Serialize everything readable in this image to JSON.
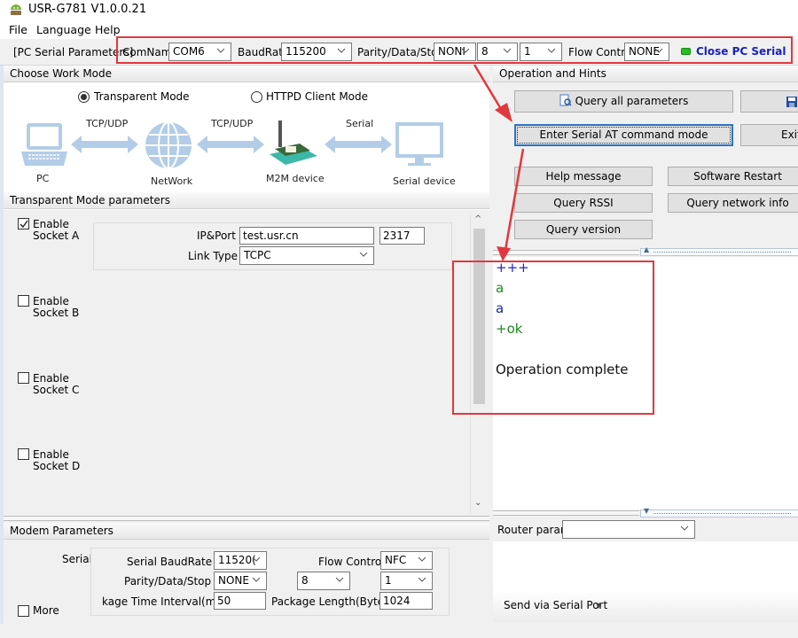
{
  "window": {
    "title": "USR-G781 V1.0.0.21",
    "app_icon": "android-robot-icon"
  },
  "menu": {
    "items": [
      "File",
      "Language",
      "Help"
    ]
  },
  "pc_serial": {
    "section_label": "[PC Serial Parameters]",
    "comname_label": "ComName",
    "comname_value": "COM6",
    "baudrate_label": "BaudRate",
    "baudrate_value": "115200",
    "parity_label": "Parity/Data/Stop",
    "parity_value": "NONI",
    "data_value": "8",
    "stop_value": "1",
    "flow_label": "Flow Control",
    "flow_value": "NONE",
    "status_color": "#22c01e",
    "close_button": "Close PC Serial",
    "close_button_color": "#1a22b8"
  },
  "work_mode": {
    "header": "Choose Work Mode",
    "options": [
      {
        "label": "Transparent Mode",
        "selected": true
      },
      {
        "label": "HTTPD Client Mode",
        "selected": false
      }
    ],
    "diagram": {
      "nodes": [
        "PC",
        "NetWork",
        "M2M device",
        "Serial device"
      ],
      "links": [
        "TCP/UDP",
        "TCP/UDP",
        "Serial"
      ]
    }
  },
  "transparent_params": {
    "header": "Transparent Mode parameters",
    "sockets": [
      {
        "line1": "Enable",
        "line2": "Socket A",
        "checked": true
      },
      {
        "line1": "Enable",
        "line2": "Socket B",
        "checked": false
      },
      {
        "line1": "Enable",
        "line2": "Socket C",
        "checked": false
      },
      {
        "line1": "Enable",
        "line2": "Socket D",
        "checked": false
      }
    ],
    "ip_port_label": "IP&Port",
    "ip_value": "test.usr.cn",
    "port_value": "2317",
    "link_type_label": "Link Type",
    "link_type_value": "TCPC"
  },
  "modem": {
    "header": "Modem Parameters",
    "serial_label": "Serial",
    "baud_label": "Serial BaudRate",
    "baud_value": "11520(",
    "flow_label": "Flow Control",
    "flow_value": "NFC",
    "parity_label": "Parity/Data/Stop",
    "parity_value": "NONE",
    "data_value": "8",
    "stop_value": "1",
    "interval_label": "kage Time Interval(ms)",
    "interval_value": "50",
    "length_label": "Package Length(Bytes)",
    "length_value": "1024",
    "more_label": "More"
  },
  "operation": {
    "header": "Operation and Hints",
    "buttons": {
      "query_all": "Query all parameters",
      "enter_at": "Enter Serial AT command mode",
      "exit": "Exit",
      "help": "Help message",
      "restart": "Software Restart",
      "rssi": "Query RSSI",
      "network": "Query network info",
      "version": "Query version"
    }
  },
  "console": {
    "lines": [
      {
        "text": "+++",
        "color": "#2424c8"
      },
      {
        "text": "a",
        "color": "#1e8a1e"
      },
      {
        "text": "a",
        "color": "#1c2a9c"
      },
      {
        "text": "+ok",
        "color": "#1e8a1e"
      },
      {
        "text": "Operation complete",
        "color": "#111111"
      }
    ]
  },
  "router": {
    "label": "Router params",
    "value": ""
  },
  "send": {
    "label": "Send via Serial Port"
  },
  "annotation": {
    "color": "#e0383e"
  }
}
